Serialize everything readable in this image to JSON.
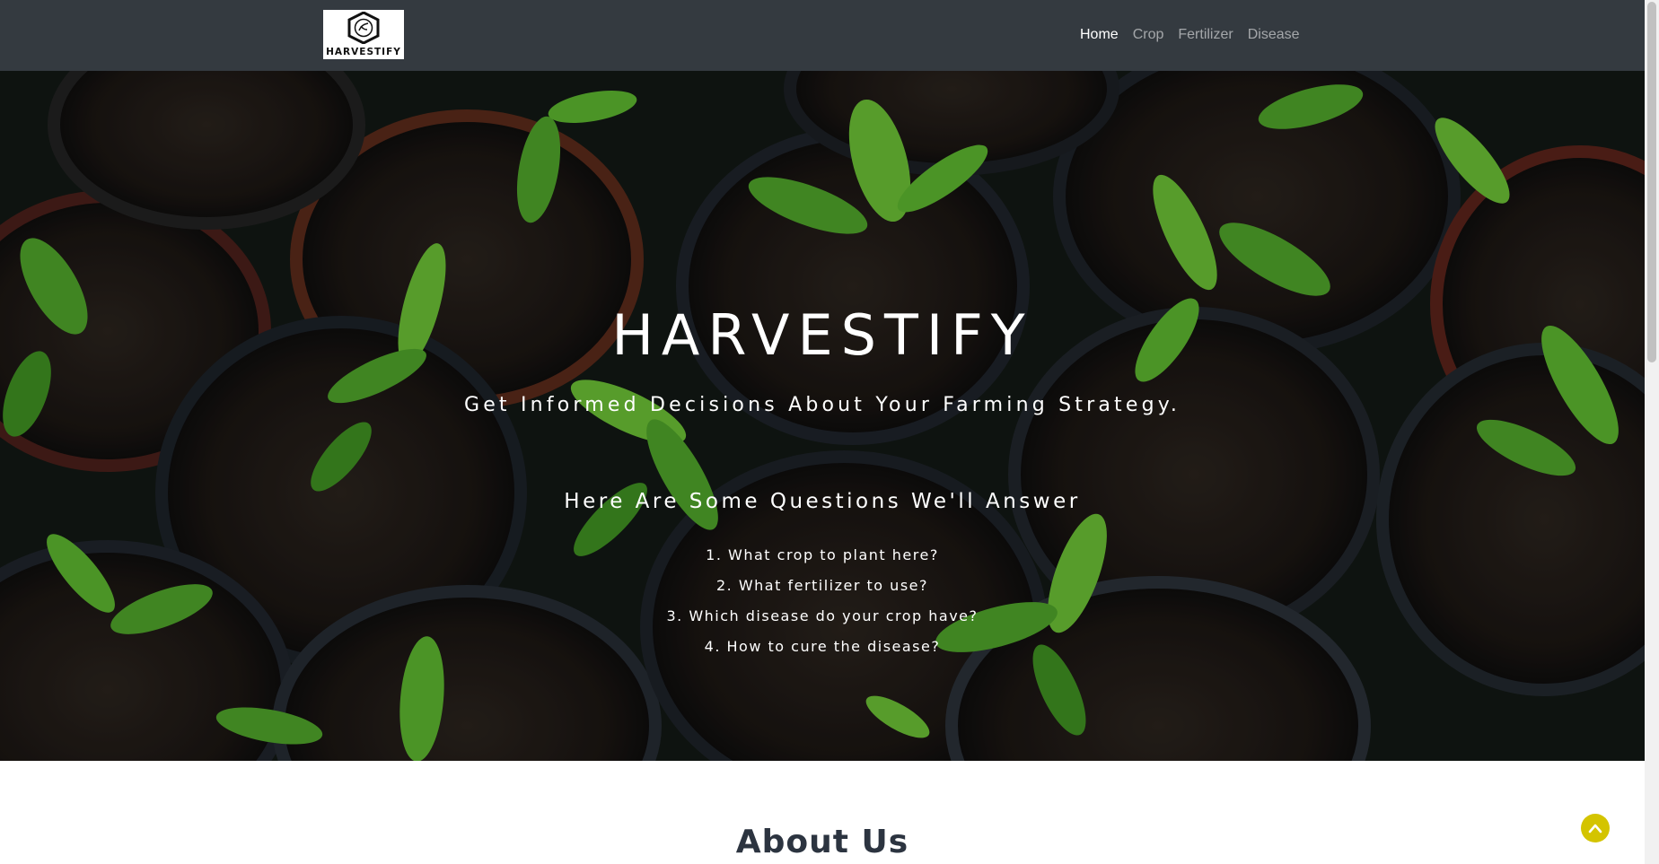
{
  "navbar": {
    "logo_text": "HARVESTIFY",
    "links": [
      {
        "label": "Home",
        "active": true
      },
      {
        "label": "Crop",
        "active": false
      },
      {
        "label": "Fertilizer",
        "active": false
      },
      {
        "label": "Disease",
        "active": false
      }
    ]
  },
  "hero": {
    "title": "HARVESTIFY",
    "subtitle": "Get Informed Decisions About Your Farming Strategy.",
    "questions_heading": "Here Are Some Questions We'll Answer",
    "questions": [
      "1. What crop to plant here?",
      "2. What fertilizer to use?",
      "3. Which disease do your crop have?",
      "4. How to cure the disease?"
    ]
  },
  "about": {
    "title": "About Us"
  },
  "back_to_top": {
    "icon": "chevron-up-icon"
  },
  "colors": {
    "navbar_bg": "#343a40",
    "nav_active": "#ffffff",
    "nav_inactive": "rgba(255,255,255,0.55)",
    "back_to_top": "#d4c400",
    "about_title": "#2c3440"
  }
}
